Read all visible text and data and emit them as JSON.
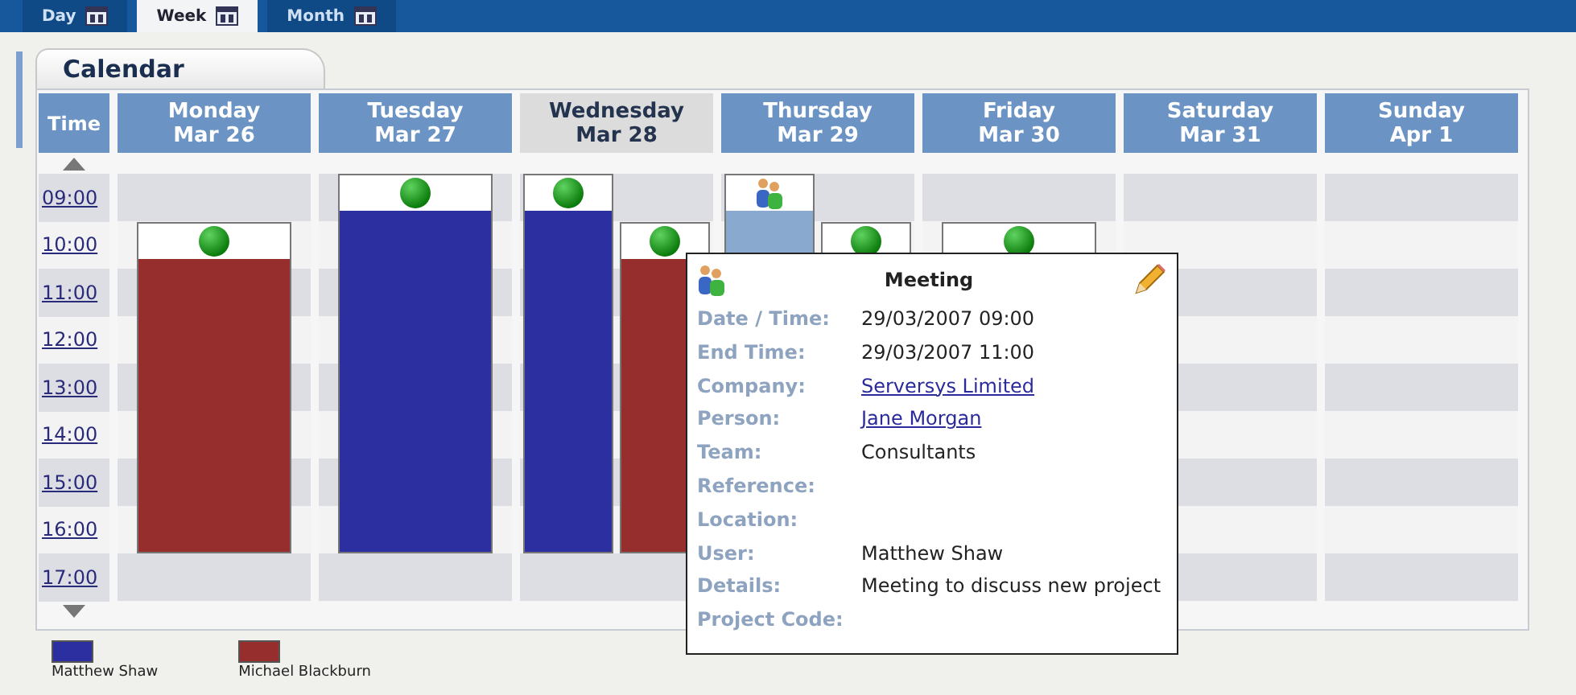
{
  "view_tabs": [
    {
      "label": "Day",
      "selected": false
    },
    {
      "label": "Week",
      "selected": true
    },
    {
      "label": "Month",
      "selected": false
    }
  ],
  "panel_tab": "Calendar",
  "time_header": "Time",
  "days": [
    {
      "day": "Monday",
      "date": "Mar 26",
      "selected": false,
      "events": [
        {
          "kind": "status",
          "color": "#962e2e"
        }
      ]
    },
    {
      "day": "Tuesday",
      "date": "Mar 27",
      "selected": false,
      "events": [
        {
          "kind": "status",
          "color": "#2b2f9f"
        }
      ]
    },
    {
      "day": "Wednesday",
      "date": "Mar 28",
      "selected": true,
      "events": [
        {
          "kind": "status",
          "color": "#2b2f9f"
        },
        {
          "kind": "status",
          "color": "#962e2e"
        }
      ]
    },
    {
      "day": "Thursday",
      "date": "Mar 29",
      "selected": false,
      "events": [
        {
          "kind": "meeting",
          "color": "#89a9cf"
        },
        {
          "kind": "status"
        }
      ]
    },
    {
      "day": "Friday",
      "date": "Mar 30",
      "selected": false,
      "events": [
        {
          "kind": "status"
        }
      ]
    },
    {
      "day": "Saturday",
      "date": "Mar 31",
      "selected": false
    },
    {
      "day": "Sunday",
      "date": "Apr 1",
      "selected": false
    }
  ],
  "times": [
    "09:00",
    "10:00",
    "11:00",
    "12:00",
    "13:00",
    "14:00",
    "15:00",
    "16:00",
    "17:00"
  ],
  "popup": {
    "title": "Meeting",
    "fields": [
      {
        "label": "Date / Time:",
        "value": "29/03/2007 09:00",
        "kind": "text"
      },
      {
        "label": "End Time:",
        "value": "29/03/2007 11:00",
        "kind": "text"
      },
      {
        "label": "Company:",
        "value": "Serversys Limited",
        "kind": "link"
      },
      {
        "label": "Person:",
        "value": "Jane Morgan",
        "kind": "link"
      },
      {
        "label": "Team:",
        "value": "Consultants",
        "kind": "text"
      },
      {
        "label": "Reference:"
      },
      {
        "label": "Location:"
      },
      {
        "label": "User:",
        "value": "Matthew Shaw",
        "kind": "text"
      },
      {
        "label": "Details:",
        "value": "Meeting to discuss new project",
        "kind": "text"
      },
      {
        "label": "Project Code:"
      }
    ]
  },
  "legend": [
    {
      "name": "Matthew Shaw",
      "color": "#2b2f9f"
    },
    {
      "name": "Michael Blackburn",
      "color": "#962e2e"
    }
  ]
}
